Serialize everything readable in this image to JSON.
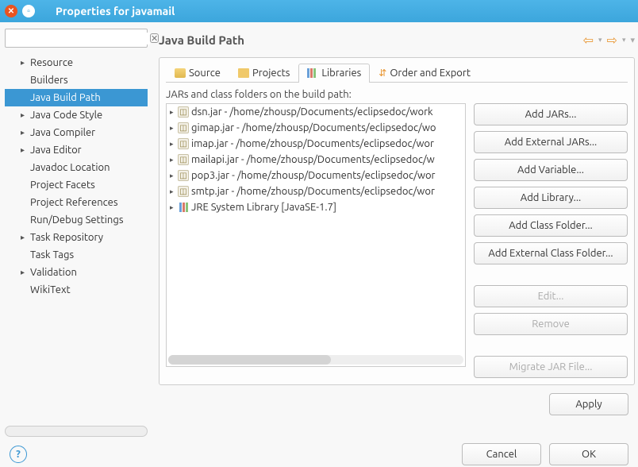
{
  "window": {
    "title": "Properties for javamail"
  },
  "sidebar": {
    "filter": "",
    "items": [
      {
        "label": "Resource",
        "expandable": true
      },
      {
        "label": "Builders",
        "expandable": false
      },
      {
        "label": "Java Build Path",
        "expandable": false,
        "selected": true
      },
      {
        "label": "Java Code Style",
        "expandable": true
      },
      {
        "label": "Java Compiler",
        "expandable": true
      },
      {
        "label": "Java Editor",
        "expandable": true
      },
      {
        "label": "Javadoc Location",
        "expandable": false
      },
      {
        "label": "Project Facets",
        "expandable": false
      },
      {
        "label": "Project References",
        "expandable": false
      },
      {
        "label": "Run/Debug Settings",
        "expandable": false
      },
      {
        "label": "Task Repository",
        "expandable": true
      },
      {
        "label": "Task Tags",
        "expandable": false
      },
      {
        "label": "Validation",
        "expandable": true
      },
      {
        "label": "WikiText",
        "expandable": false
      }
    ]
  },
  "main": {
    "title": "Java Build Path",
    "tabs": [
      "Source",
      "Projects",
      "Libraries",
      "Order and Export"
    ],
    "active_tab": 2,
    "subtitle": "JARs and class folders on the build path:",
    "jars": [
      {
        "kind": "jar",
        "text": "dsn.jar - /home/zhousp/Documents/eclipsedoc/work"
      },
      {
        "kind": "jar",
        "text": "gimap.jar - /home/zhousp/Documents/eclipsedoc/wo"
      },
      {
        "kind": "jar",
        "text": "imap.jar - /home/zhousp/Documents/eclipsedoc/wor"
      },
      {
        "kind": "jar",
        "text": "mailapi.jar - /home/zhousp/Documents/eclipsedoc/w"
      },
      {
        "kind": "jar",
        "text": "pop3.jar - /home/zhousp/Documents/eclipsedoc/wor"
      },
      {
        "kind": "jar",
        "text": "smtp.jar - /home/zhousp/Documents/eclipsedoc/wor"
      },
      {
        "kind": "jre",
        "text": "JRE System Library [JavaSE-1.7]"
      }
    ],
    "buttons": {
      "add_jars": "Add JARs...",
      "add_ext_jars": "Add External JARs...",
      "add_variable": "Add Variable...",
      "add_library": "Add Library...",
      "add_class_folder": "Add Class Folder...",
      "add_ext_class_folder": "Add External Class Folder...",
      "edit": "Edit...",
      "remove": "Remove",
      "migrate": "Migrate JAR File..."
    },
    "apply": "Apply"
  },
  "footer": {
    "cancel": "Cancel",
    "ok": "OK"
  }
}
